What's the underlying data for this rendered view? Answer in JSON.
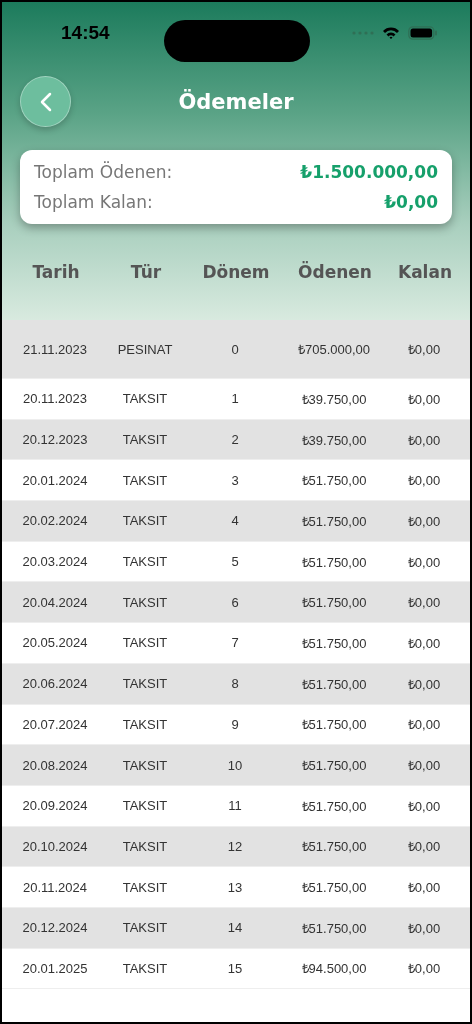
{
  "status_bar": {
    "time": "14:54"
  },
  "header": {
    "title": "Ödemeler"
  },
  "summary": [
    {
      "label": "Toplam Ödenen:",
      "value": "₺1.500.000,00"
    },
    {
      "label": "Toplam Kalan:",
      "value": "₺0,00"
    }
  ],
  "table": {
    "columns": [
      "Tarih",
      "Tür",
      "Dönem",
      "Ödenen",
      "Kalan"
    ],
    "rows": [
      [
        "21.11.2023",
        "PESINAT",
        "0",
        "₺705.000,00",
        "₺0,00"
      ],
      [
        "20.11.2023",
        "TAKSIT",
        "1",
        "₺39.750,00",
        "₺0,00"
      ],
      [
        "20.12.2023",
        "TAKSIT",
        "2",
        "₺39.750,00",
        "₺0,00"
      ],
      [
        "20.01.2024",
        "TAKSIT",
        "3",
        "₺51.750,00",
        "₺0,00"
      ],
      [
        "20.02.2024",
        "TAKSIT",
        "4",
        "₺51.750,00",
        "₺0,00"
      ],
      [
        "20.03.2024",
        "TAKSIT",
        "5",
        "₺51.750,00",
        "₺0,00"
      ],
      [
        "20.04.2024",
        "TAKSIT",
        "6",
        "₺51.750,00",
        "₺0,00"
      ],
      [
        "20.05.2024",
        "TAKSIT",
        "7",
        "₺51.750,00",
        "₺0,00"
      ],
      [
        "20.06.2024",
        "TAKSIT",
        "8",
        "₺51.750,00",
        "₺0,00"
      ],
      [
        "20.07.2024",
        "TAKSIT",
        "9",
        "₺51.750,00",
        "₺0,00"
      ],
      [
        "20.08.2024",
        "TAKSIT",
        "10",
        "₺51.750,00",
        "₺0,00"
      ],
      [
        "20.09.2024",
        "TAKSIT",
        "11",
        "₺51.750,00",
        "₺0,00"
      ],
      [
        "20.10.2024",
        "TAKSIT",
        "12",
        "₺51.750,00",
        "₺0,00"
      ],
      [
        "20.11.2024",
        "TAKSIT",
        "13",
        "₺51.750,00",
        "₺0,00"
      ],
      [
        "20.12.2024",
        "TAKSIT",
        "14",
        "₺51.750,00",
        "₺0,00"
      ],
      [
        "20.01.2025",
        "TAKSIT",
        "15",
        "₺94.500,00",
        "₺0,00"
      ]
    ]
  }
}
